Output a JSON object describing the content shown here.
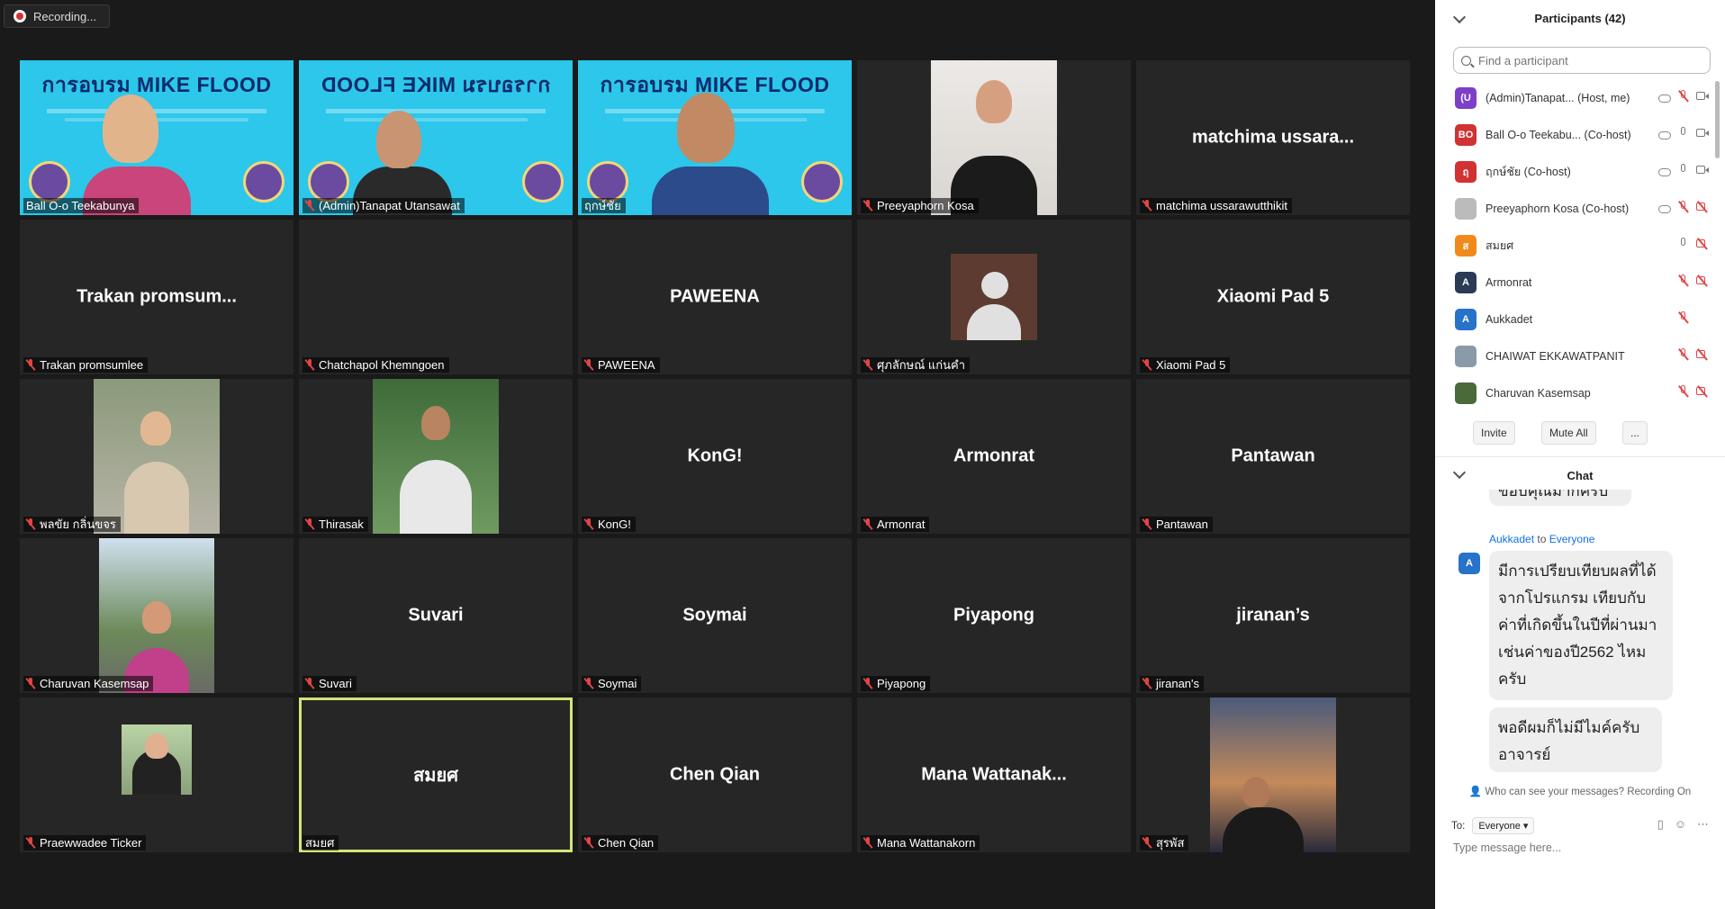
{
  "recording": {
    "label": "Recording..."
  },
  "tiles": [
    {
      "label": "Ball O-o Teekabunya",
      "kind": "banner"
    },
    {
      "label": "(Admin)Tanapat Utansawat",
      "kind": "banner-mirror"
    },
    {
      "label": "ฤกษ์ชัย",
      "kind": "banner"
    },
    {
      "label": "Preeyaphorn Kosa",
      "kind": "photo"
    },
    {
      "label": "matchima ussarawutthikit",
      "name": "matchima ussara...",
      "kind": "name"
    },
    {
      "label": "Trakan promsumlee",
      "name": "Trakan promsum...",
      "kind": "name"
    },
    {
      "label": "Chatchapol Khemngoen",
      "kind": "blank"
    },
    {
      "label": "PAWEENA",
      "name": "PAWEENA",
      "kind": "name"
    },
    {
      "label": "ศุภลักษณ์ แก่นคำ",
      "kind": "avatar"
    },
    {
      "label": "Xiaomi Pad 5",
      "name": "Xiaomi Pad 5",
      "kind": "name"
    },
    {
      "label": "พลขัย กลิ่นขจร",
      "kind": "photo"
    },
    {
      "label": "Thirasak",
      "kind": "photo"
    },
    {
      "label": "KonG!",
      "name": "KonG!",
      "kind": "name"
    },
    {
      "label": "Armonrat",
      "name": "Armonrat",
      "kind": "name"
    },
    {
      "label": "Pantawan",
      "name": "Pantawan",
      "kind": "name"
    },
    {
      "label": "Charuvan Kasemsap",
      "kind": "photo"
    },
    {
      "label": "Suvari",
      "name": "Suvari",
      "kind": "name"
    },
    {
      "label": "Soymai",
      "name": "Soymai",
      "kind": "name"
    },
    {
      "label": "Piyapong",
      "name": "Piyapong",
      "kind": "name"
    },
    {
      "label": "jiranan's",
      "name": "jiranan’s",
      "kind": "name"
    },
    {
      "label": "Praewwadee Ticker",
      "kind": "photo"
    },
    {
      "label": "สมยศ",
      "name": "สมยศ",
      "kind": "name",
      "active": true
    },
    {
      "label": "Chen Qian",
      "name": "Chen Qian",
      "kind": "name"
    },
    {
      "label": "Mana Wattanakorn",
      "name": "Mana Wattanak...",
      "kind": "name"
    },
    {
      "label": "สุรพัส",
      "kind": "photo"
    }
  ],
  "banner": {
    "title": "การอบรม MIKE FLOOD"
  },
  "participants": {
    "title": "Participants (42)",
    "search_placeholder": "Find a participant",
    "list": [
      {
        "initials": "(U",
        "name": "(Admin)Tanapat... (Host, me)",
        "color": "#7d3fc7",
        "mic": "off",
        "cam": "on"
      },
      {
        "initials": "BO",
        "name": "Ball O-o Teekabu... (Co-host)",
        "color": "#d13232",
        "mic": "on",
        "cam": "on"
      },
      {
        "initials": "ฤ",
        "name": "ฤกษ์ชัย (Co-host)",
        "color": "#d13232",
        "mic": "on",
        "cam": "on"
      },
      {
        "initials": "",
        "name": "Preeyaphorn Kosa (Co-host)",
        "color": "#bbbbbb",
        "mic": "off",
        "cam": "off"
      },
      {
        "initials": "ส",
        "name": "สมยศ",
        "color": "#f08a1c",
        "mic": "on",
        "cam": "off"
      },
      {
        "initials": "A",
        "name": "Armonrat",
        "color": "#2b3a55",
        "mic": "off",
        "cam": "off"
      },
      {
        "initials": "A",
        "name": "Aukkadet",
        "color": "#2773c9",
        "mic": "off",
        "cam": "none"
      },
      {
        "initials": "",
        "name": "CHAIWAT EKKAWATPANIT",
        "color": "#8a9aa8",
        "mic": "off",
        "cam": "off"
      },
      {
        "initials": "",
        "name": "Charuvan Kasemsap",
        "color": "#4a6a3a",
        "mic": "off",
        "cam": "off"
      }
    ],
    "invite": "Invite",
    "mute_all": "Mute All",
    "more": "..."
  },
  "chat": {
    "title": "Chat",
    "partial_message": "ขอบคุณมากครับ",
    "sender": "Aukkadet",
    "to_word": "to",
    "recipient": "Everyone",
    "avatar": "A",
    "message1": "มีการเปรียบเทียบผลที่ได้จากโปรแกรม เทียบกับค่าที่เกิดขึ้นในปีที่ผ่านมาเช่นค่าของปี2562 ไหมครับ",
    "message2": "พอดีผมก็ไม่มีไมค์ครับ อาจารย์",
    "visibility": "Who can see your messages? Recording On",
    "to_label": "To:",
    "to_value": "Everyone",
    "placeholder": "Type message here..."
  }
}
